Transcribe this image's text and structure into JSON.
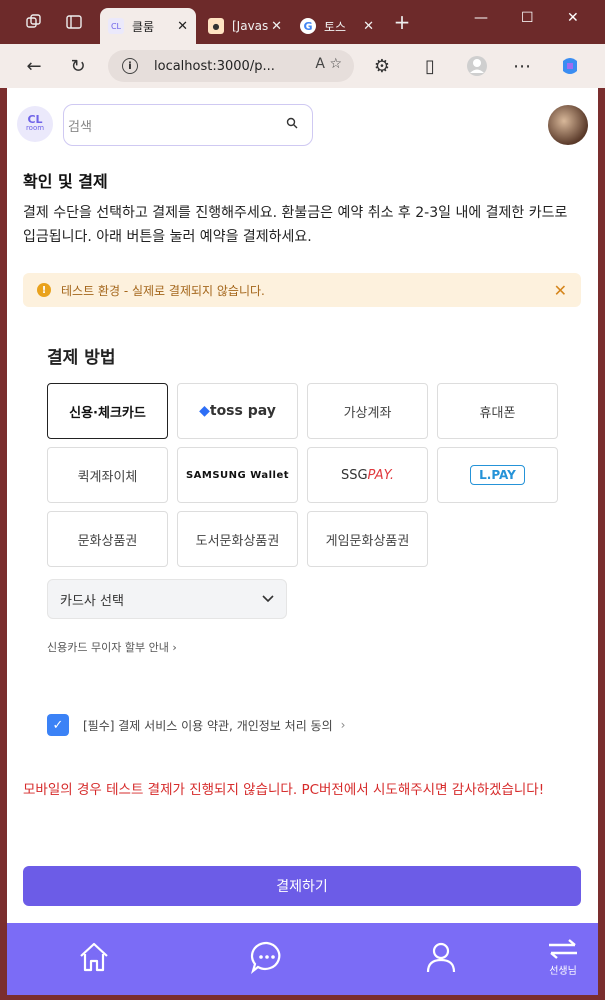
{
  "browser": {
    "tabs": [
      {
        "label": "클룸",
        "active": true
      },
      {
        "label": "[Javas",
        "active": false
      },
      {
        "label": "토스",
        "active": false
      }
    ],
    "url": "localhost:3000/p..."
  },
  "header": {
    "logo_top": "CL",
    "logo_bottom": "room",
    "search_placeholder": "검색"
  },
  "main": {
    "title": "확인 및 결제",
    "description": "결제 수단을 선택하고 결제를 진행해주세요. 환불금은 예약 취소 후 2-3일 내에 결제한 카드로 입금됩니다. 아래 버튼을 눌러 예약을 결제하세요.",
    "alert": "테스트 환경 - 실제로 결제되지 않습니다.",
    "payment_methods_title": "결제 방법",
    "payment_methods": [
      {
        "label": "신용·체크카드",
        "selected": true
      },
      {
        "label": "toss pay",
        "selected": false
      },
      {
        "label": "가상계좌",
        "selected": false
      },
      {
        "label": "휴대폰",
        "selected": false
      },
      {
        "label": "퀵계좌이체",
        "selected": false
      },
      {
        "label": "SAMSUNG Wallet",
        "selected": false
      },
      {
        "label": "SSGPAY.",
        "selected": false
      },
      {
        "label": "L.PAY",
        "selected": false
      },
      {
        "label": "문화상품권",
        "selected": false
      },
      {
        "label": "도서문화상품권",
        "selected": false
      },
      {
        "label": "게임문화상품권",
        "selected": false
      }
    ],
    "card_select": "카드사 선택",
    "installment_info": "신용카드 무이자 할부 안내",
    "agreement": "[필수] 결제 서비스 이용 약관, 개인정보 처리 동의",
    "agreement_checked": true,
    "mobile_warning": "모바일의 경우 테스트 결제가 진행되지 않습니다. PC버전에서 시도해주시면 감사하겠습니다!",
    "pay_button": "결제하기"
  },
  "bottom_nav": {
    "switch_label": "선생님"
  },
  "colors": {
    "accent": "#6c5ce7",
    "nav": "#7b6cf6",
    "warning_text": "#d62b2b",
    "alert_bg": "#fdf1dd",
    "checkbox": "#3b82f6"
  }
}
